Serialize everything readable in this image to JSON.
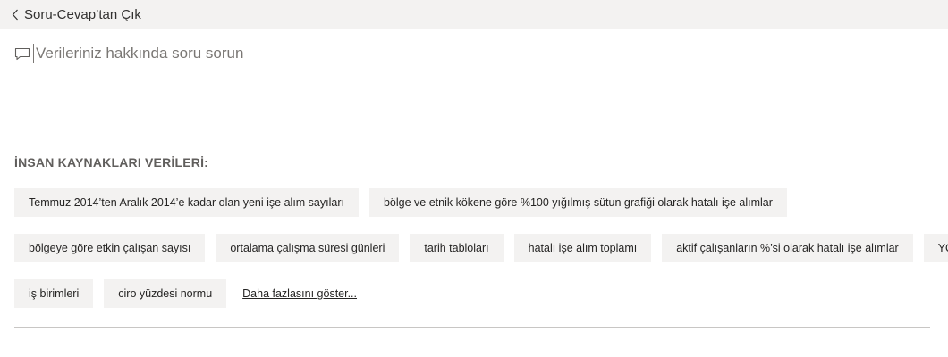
{
  "topbar": {
    "back_label": "Soru-Cevap’tan Çık",
    "back_icon": "chevron-left-icon"
  },
  "qa": {
    "icon": "chat-icon",
    "placeholder": "Verileriniz hakkında soru sorun",
    "value": ""
  },
  "suggestions": {
    "title": "İNSAN KAYNAKLARI VERİLERİ:",
    "rows": [
      [
        "Temmuz 2014’ten Aralık 2014’e kadar olan yeni işe alım sayıları",
        "bölge ve etnik kökene göre %100 yığılmış sütun grafiği olarak hatalı işe alımlar"
      ],
      [
        "bölgeye göre etkin çalışan sayısı",
        "ortalama çalışma süresi günleri",
        "tarih tabloları",
        "hatalı işe alım toplamı",
        "aktif çalışanların %’si olarak hatalı işe alımlar",
        "YQM"
      ],
      [
        "iş birimleri",
        "ciro yüzdesi normu"
      ]
    ],
    "show_more": "Daha fazlasını göster..."
  }
}
